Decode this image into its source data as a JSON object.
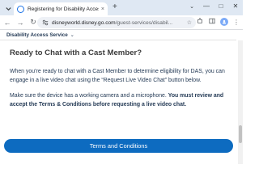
{
  "browser": {
    "tab": {
      "title": "Registering for Disability Access",
      "close_glyph": "×"
    },
    "newtab_glyph": "+",
    "window_controls": {
      "chevron": "⌄",
      "minimize": "—",
      "maximize": "□",
      "close": "✕"
    },
    "toolbar": {
      "back": "←",
      "forward": "→",
      "reload": "↻",
      "url_host": "disneyworld.disney.go.com",
      "url_path": "/guest-services/disabil...",
      "icons": [
        "bookmark-star-icon",
        "extensions-icon",
        "sidepanel-icon",
        "profile-icon",
        "menu-icon"
      ]
    }
  },
  "page": {
    "subheader": {
      "label": "Disability Access Service",
      "chevron": "⌄"
    },
    "heading": "Ready to Chat with a Cast Member?",
    "paragraph_1": "When you’re ready to chat with a Cast Member to determine eligibility for DAS, you can engage in a live video chat using the “Request Live Video Chat” button below.",
    "paragraph_2_plain": "Make sure the device has a working camera and a microphone. ",
    "paragraph_2_bold": "You must review and accept the Terms & Conditions before requesting a live video chat.",
    "cta_label": "Terms and Conditions"
  },
  "colors": {
    "accent": "#0d6bc0",
    "text": "#253b56",
    "tabstrip": "#dfe8f3"
  }
}
